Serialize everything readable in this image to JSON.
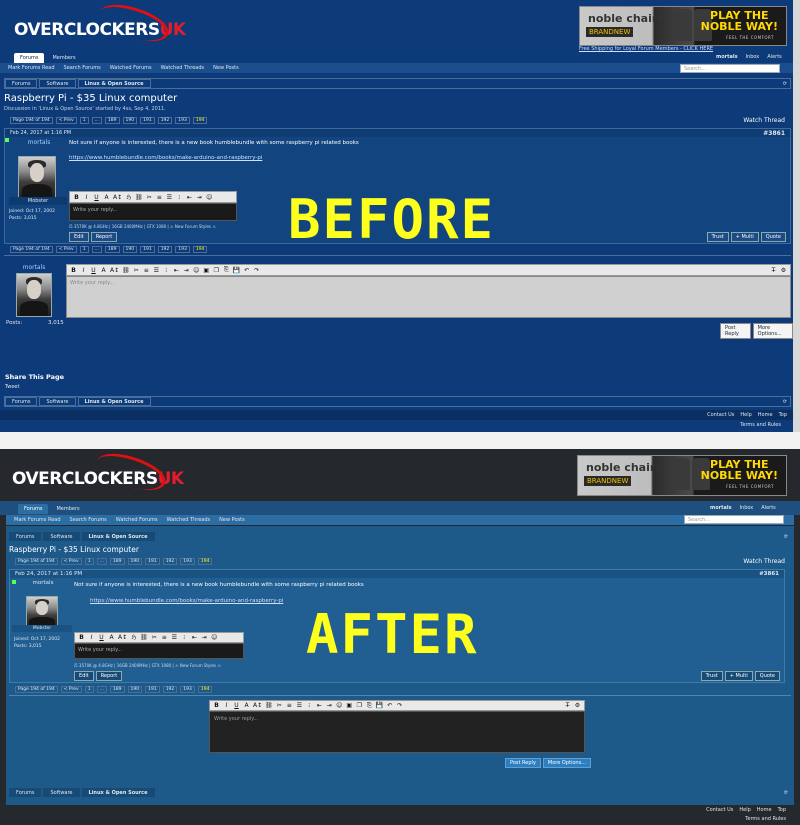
{
  "before": {
    "label": "BEFORE",
    "logo": {
      "main": "OVERCLOCKERS",
      "suffix": "UK"
    },
    "ad": {
      "brand": "noble chairs",
      "new": "BRANDNEW",
      "play": "PLAY THE\nNOBLE WAY!",
      "feel": "FEEL THE COMFORT"
    },
    "promo": "Free Shipping for Loyal Forum Members - CLICK HERE",
    "tabs": [
      "Forums",
      "Members"
    ],
    "account": [
      "mortals",
      "Inbox",
      "Alerts"
    ],
    "subnav": [
      "Mark Forums Read",
      "Search Forums",
      "Watched Forums",
      "Watched Threads",
      "New Posts"
    ],
    "search_placeholder": "Search...",
    "breadcrumbs": [
      "Forums",
      "Software",
      "Linux & Open Source"
    ],
    "title": "Raspberry Pi - $35 Linux computer",
    "subtitle": "Discussion in 'Linux & Open Source' started by 4ss, Sep 4, 2011.",
    "pager": {
      "label": "Page 194 of 194",
      "prev": "< Prev",
      "pages": [
        "1",
        "...",
        "189",
        "190",
        "191",
        "192",
        "193",
        "194"
      ]
    },
    "watch": "Watch Thread",
    "post": {
      "date": "Feb 24, 2017 at 1:16 PM",
      "number": "#3861",
      "user": "mortals",
      "role": "Mobster",
      "joined": "Joined: Oct 17, 2002",
      "posts": "Posts: 3,015",
      "text": "Not sure if anyone is interested, there is a new book humblebundle with some raspberry pi related books",
      "link": "https://www.humblebundle.com/books/make-arduino-and-raspberry-pi",
      "quick_reply": "Write your reply...",
      "sig": "i5 3570K @ 4.8GHz | 16GB 2400MHz | GTX 1080 | ⚠ New Forum Styles ⚠",
      "edit": "Edit",
      "report": "Report",
      "trust": "Trust",
      "multi": "+ Multi",
      "quote": "Quote"
    },
    "reply": {
      "user": "mortals",
      "posts_label": "Posts:",
      "posts_value": "3,015",
      "placeholder": "Write your reply...",
      "post_btn": "Post Reply",
      "more_btn": "More Options..."
    },
    "share": {
      "title": "Share This Page",
      "tweet": "Tweet"
    },
    "footer": [
      "Contact Us",
      "Help",
      "Home",
      "Top"
    ],
    "terms": "Terms and Rules"
  },
  "after": {
    "label": "AFTER",
    "tabs": [
      "Forums",
      "Members"
    ],
    "account": [
      "mortals",
      "Inbox",
      "Alerts"
    ],
    "subnav": [
      "Mark Forums Read",
      "Search Forums",
      "Watched Forums",
      "Watched Threads",
      "New Posts"
    ],
    "search_placeholder": "Search...",
    "breadcrumbs": [
      "Forums",
      "Software",
      "Linux & Open Source"
    ],
    "title": "Raspberry Pi - $35 Linux computer",
    "pager": {
      "label": "Page 194 of 194",
      "prev": "< Prev",
      "pages": [
        "1",
        "...",
        "189",
        "190",
        "191",
        "192",
        "193",
        "194"
      ]
    },
    "watch": "Watch Thread",
    "post": {
      "date": "Feb 24, 2017 at 1:16 PM",
      "number": "#3861",
      "user": "mortals",
      "role": "Mobster",
      "joined": "Joined: Oct 17, 2002",
      "posts": "Posts: 3,015",
      "text": "Not sure if anyone is interested, there is a new book humblebundle with some raspberry pi related books",
      "link": "https://www.humblebundle.com/books/make-arduino-and-raspberry-pi",
      "quick_reply": "Write your reply...",
      "sig": "i5 3570K @ 4.8GHz | 16GB 2400MHz | GTX 1080 | ⚠ New Forum Styles ⚠",
      "edit": "Edit",
      "report": "Report",
      "trust": "Trust",
      "multi": "+ Multi",
      "quote": "Quote"
    },
    "reply": {
      "placeholder": "Write your reply...",
      "post_btn": "Post Reply",
      "more_btn": "More Options..."
    },
    "footer": [
      "Contact Us",
      "Help",
      "Home",
      "Top"
    ],
    "terms": "Terms and Rules"
  },
  "toolbar_icons": [
    "B",
    "I",
    "U",
    "A",
    "A↕",
    "ℌ",
    "🔗",
    "⛓",
    "≡",
    "☰",
    "⁝",
    "⇤",
    "⇥",
    "☺",
    "▣",
    "❐",
    "⎘",
    "💾",
    "↶",
    "↷"
  ],
  "colors": {
    "before_bg": "#0d3a78",
    "after_bg": "#25282d",
    "after_panel": "#1d5a8a",
    "label": "#ffff1e",
    "accent": "#e31d2b"
  }
}
